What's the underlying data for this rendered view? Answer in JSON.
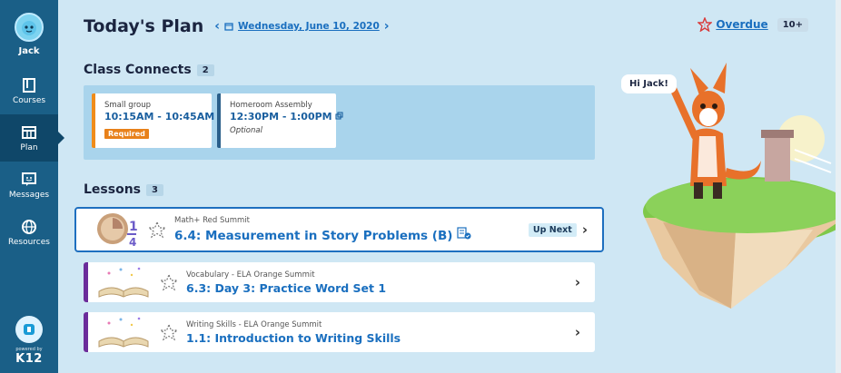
{
  "user": {
    "name": "Jack"
  },
  "sidebar": {
    "items": [
      {
        "label": "Courses",
        "icon": "book-icon"
      },
      {
        "label": "Plan",
        "icon": "calendar-plan-icon",
        "active": true
      },
      {
        "label": "Messages",
        "icon": "message-icon"
      },
      {
        "label": "Resources",
        "icon": "globe-icon"
      }
    ],
    "powered_by": "powered by",
    "brand": "K12"
  },
  "header": {
    "title": "Today's Plan",
    "date": "Wednesday, June 10, 2020",
    "overdue_label": "Overdue",
    "overdue_count": "10+"
  },
  "class_connects": {
    "title": "Class Connects",
    "count": "2",
    "cards": [
      {
        "name": "Small group",
        "time": "10:15AM - 10:45AM ...",
        "tag": "Required"
      },
      {
        "name": "Homeroom Assembly",
        "time": "12:30PM - 1:00PM",
        "tag": "Optional"
      }
    ]
  },
  "lessons": {
    "title": "Lessons",
    "count": "3",
    "items": [
      {
        "subject": "Math+ Red Summit",
        "title": "6.4: Measurement in Story Problems (B)",
        "badge": "Up Next"
      },
      {
        "subject": "Vocabulary - ELA Orange Summit",
        "title": "6.3: Day 3: Practice Word Set 1"
      },
      {
        "subject": "Writing Skills - ELA Orange Summit",
        "title": "1.1: Introduction to Writing Skills"
      }
    ]
  },
  "scene": {
    "greeting": "Hi Jack!"
  },
  "colors": {
    "sidebar": "#1a5f87",
    "accent": "#1a6fbf",
    "required": "#e8811a",
    "lesson_accent": "#6b2c9a"
  }
}
